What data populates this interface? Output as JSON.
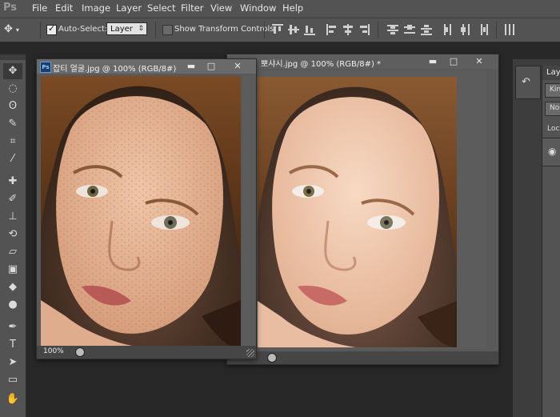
{
  "app": {
    "logo": "Ps"
  },
  "menu": [
    "File",
    "Edit",
    "Image",
    "Layer",
    "Select",
    "Filter",
    "View",
    "Window",
    "Help"
  ],
  "options": {
    "auto_select_label": "Auto-Select:",
    "auto_select_checked": true,
    "layer_value": "Layer",
    "show_transform_label": "Show Transform Controls",
    "show_transform_checked": false
  },
  "documents": [
    {
      "title": "잡티 얼굴.jpg @ 100% (RGB/8#)",
      "zoom": "100%",
      "active": true
    },
    {
      "title": "뽀샤시.jpg @ 100% (RGB/8#) *",
      "active": false
    }
  ],
  "window_buttons": {
    "minimize": "▬",
    "maximize": "□",
    "close": "✕"
  },
  "layers_panel": {
    "tab_label": "Laye",
    "kind_label": "Kin",
    "normal_label": "Nor",
    "lock_label": "Lock"
  },
  "colors": {
    "chrome": "#535353",
    "workspace": "#282828",
    "accent": "#1c3c6a"
  }
}
